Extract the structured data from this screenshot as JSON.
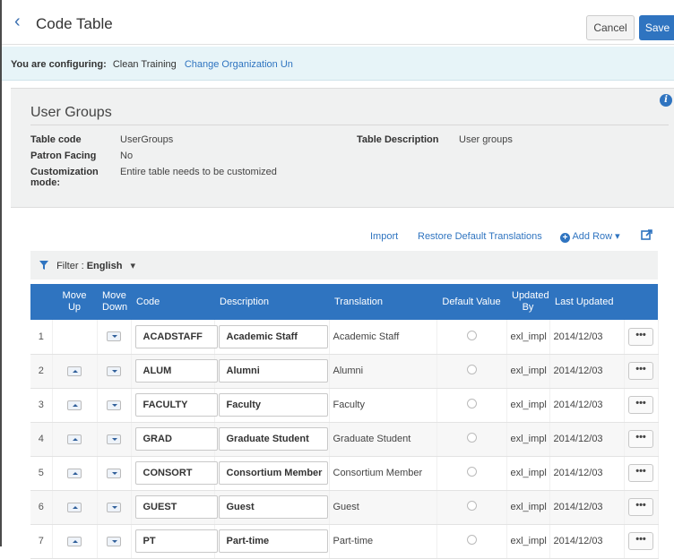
{
  "header": {
    "title": "Code Table",
    "cancel_label": "Cancel",
    "save_label": "Save"
  },
  "config_bar": {
    "prefix": "You are configuring:",
    "org": "Clean Training",
    "change_link": "Change Organization Un"
  },
  "panel": {
    "title": "User Groups",
    "table_code_label": "Table code",
    "table_code": "UserGroups",
    "patron_facing_label": "Patron Facing",
    "patron_facing": "No",
    "custom_label_1": "Customization",
    "custom_label_2": "mode:",
    "custom_value": "Entire table needs to be customized",
    "desc_label": "Table Description",
    "desc_value": "User groups"
  },
  "toolbar": {
    "import": "Import",
    "restore": "Restore Default Translations",
    "add_row": "Add Row"
  },
  "filter": {
    "label": "Filter :",
    "value": "English"
  },
  "columns": {
    "move_up_1": "Move",
    "move_up_2": "Up",
    "move_down_1": "Move",
    "move_down_2": "Down",
    "code": "Code",
    "description": "Description",
    "translation": "Translation",
    "default": "Default Value",
    "updated_by_1": "Updated",
    "updated_by_2": "By",
    "last_updated": "Last Updated"
  },
  "rows": [
    {
      "n": "1",
      "code": "ACADSTAFF",
      "desc": "Academic Staff",
      "trans": "Academic Staff",
      "by": "exl_impl",
      "date": "2014/12/03",
      "more": "•••"
    },
    {
      "n": "2",
      "code": "ALUM",
      "desc": "Alumni",
      "trans": "Alumni",
      "by": "exl_impl",
      "date": "2014/12/03",
      "more": "•••"
    },
    {
      "n": "3",
      "code": "FACULTY",
      "desc": "Faculty",
      "trans": "Faculty",
      "by": "exl_impl",
      "date": "2014/12/03",
      "more": "•••"
    },
    {
      "n": "4",
      "code": "GRAD",
      "desc": "Graduate Student",
      "trans": "Graduate Student",
      "by": "exl_impl",
      "date": "2014/12/03",
      "more": "•••"
    },
    {
      "n": "5",
      "code": "CONSORT",
      "desc": "Consortium Member",
      "trans": "Consortium Member",
      "by": "exl_impl",
      "date": "2014/12/03",
      "more": "•••"
    },
    {
      "n": "6",
      "code": "GUEST",
      "desc": "Guest",
      "trans": "Guest",
      "by": "exl_impl",
      "date": "2014/12/03",
      "more": "•••"
    },
    {
      "n": "7",
      "code": "PT",
      "desc": "Part-time",
      "trans": "Part-time",
      "by": "exl_impl",
      "date": "2014/12/03",
      "more": "•••"
    }
  ]
}
